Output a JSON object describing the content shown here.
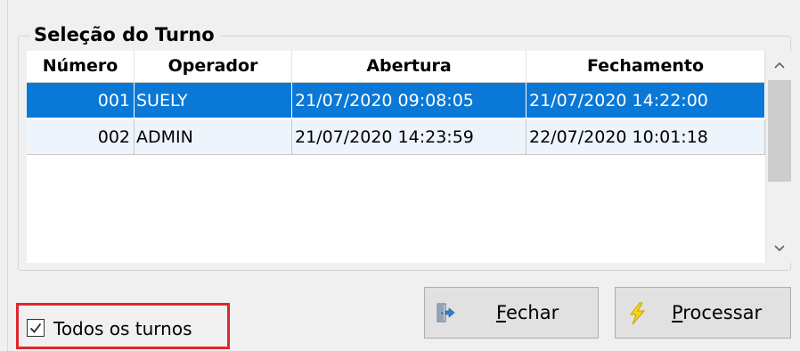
{
  "group": {
    "title": "Seleção do Turno"
  },
  "table": {
    "columns": [
      "Número",
      "Operador",
      "Abertura",
      "Fechamento"
    ],
    "rows": [
      {
        "numero": "001",
        "operador": "SUELY",
        "abertura": "21/07/2020 09:08:05",
        "fechamento": "21/07/2020 14:22:00",
        "selected": true
      },
      {
        "numero": "002",
        "operador": "ADMIN",
        "abertura": "21/07/2020 14:23:59",
        "fechamento": "22/07/2020 10:01:18",
        "selected": false
      }
    ]
  },
  "scrollbar": {
    "up_icon": "chevron-up-icon",
    "down_icon": "chevron-down-icon",
    "up_glyph": "^",
    "down_glyph": "v"
  },
  "checkbox": {
    "label": "Todos os turnos",
    "checked": true
  },
  "buttons": {
    "fechar": {
      "accel": "F",
      "rest": "echar",
      "icon": "exit-door-icon"
    },
    "processar": {
      "accel": "P",
      "rest": "rocessar",
      "icon": "lightning-icon"
    }
  },
  "colors": {
    "selection": "#0a78d7",
    "highlight_border": "#e0262e",
    "lightning": "#f5d21c"
  }
}
